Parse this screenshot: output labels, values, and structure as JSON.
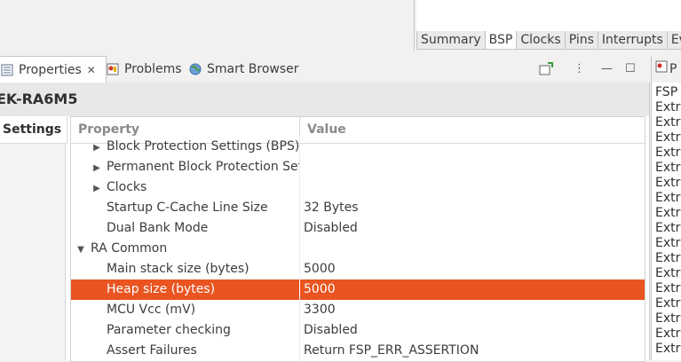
{
  "editor_tabs": [
    "Summary",
    "BSP",
    "Clocks",
    "Pins",
    "Interrupts",
    "Eve"
  ],
  "active_editor_tab": "BSP",
  "view_tabs": {
    "properties": "Properties",
    "problems": "Problems",
    "smart_browser": "Smart Browser"
  },
  "panel_title": "EK-RA6M5",
  "settings_tab": "Settings",
  "table": {
    "headers": {
      "property": "Property",
      "value": "Value"
    },
    "rows": [
      {
        "property": "Block Protection Settings (BPS)",
        "value": "",
        "expander": "collapsed",
        "indent": 1
      },
      {
        "property": "Permanent Block Protection Setti",
        "value": "",
        "expander": "collapsed",
        "indent": 1
      },
      {
        "property": "Clocks",
        "value": "",
        "expander": "collapsed",
        "indent": 1
      },
      {
        "property": "Startup C-Cache Line Size",
        "value": "32 Bytes",
        "expander": "none",
        "indent": 1
      },
      {
        "property": "Dual Bank Mode",
        "value": "Disabled",
        "expander": "none",
        "indent": 1
      },
      {
        "property": "RA Common",
        "value": "",
        "expander": "expanded",
        "indent": 0
      },
      {
        "property": "Main stack size (bytes)",
        "value": "5000",
        "expander": "none",
        "indent": 1
      },
      {
        "property": "Heap size (bytes)",
        "value": "5000",
        "expander": "none",
        "indent": 1,
        "selected": true
      },
      {
        "property": "MCU Vcc (mV)",
        "value": "3300",
        "expander": "none",
        "indent": 1
      },
      {
        "property": "Parameter checking",
        "value": "Disabled",
        "expander": "none",
        "indent": 1
      },
      {
        "property": "Assert Failures",
        "value": "Return FSP_ERR_ASSERTION",
        "expander": "none",
        "indent": 1
      }
    ]
  },
  "right_panel": {
    "tab": "P",
    "lines": [
      "FSP",
      "Extr",
      "Extr",
      "Extr",
      "Extr",
      "Extr",
      "Extr",
      "Extr",
      "Extr",
      "Extr",
      "Extr",
      "Extr",
      "Extr",
      "Extr",
      "Extr",
      "Extr",
      "Extr",
      "Extr"
    ]
  },
  "colors": {
    "selection": "#e95420",
    "background": "#f2f1f0"
  }
}
